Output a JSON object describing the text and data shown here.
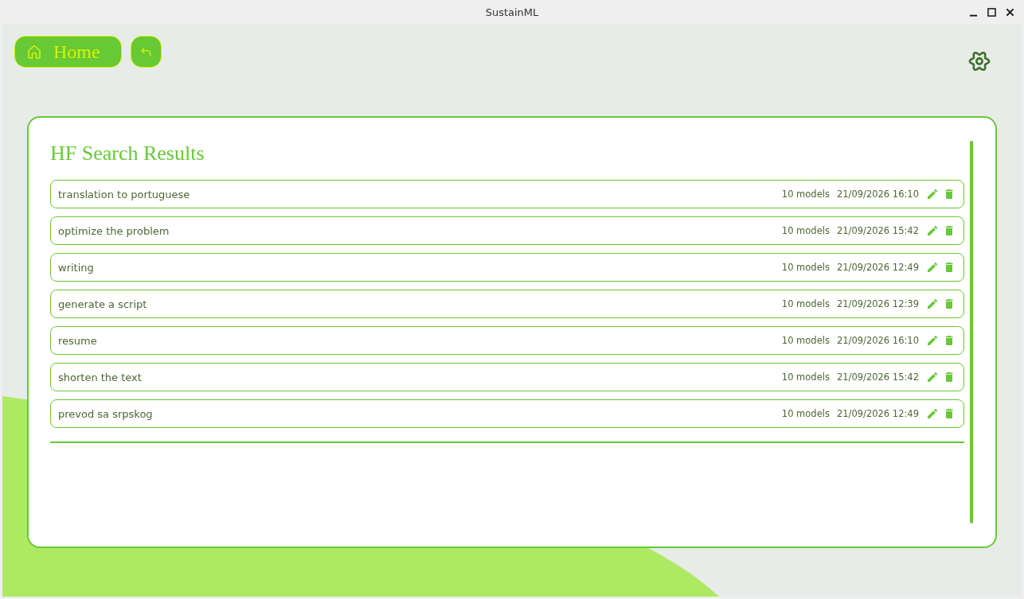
{
  "window": {
    "title": "SustainML"
  },
  "toolbar": {
    "home_button": {
      "label": "Home"
    }
  },
  "results": {
    "title": "HF Search Results",
    "items": [
      {
        "query": "translation to portuguese",
        "models": "10 models",
        "date": "21/09/2026 16:10"
      },
      {
        "query": "optimize the problem",
        "models": "10 models",
        "date": "21/09/2026 15:42"
      },
      {
        "query": "writing",
        "models": "10 models",
        "date": "21/09/2026 12:49"
      },
      {
        "query": "generate a script",
        "models": "10 models",
        "date": "21/09/2026 12:39"
      },
      {
        "query": "resume",
        "models": "10 models",
        "date": "21/09/2026 16:10"
      },
      {
        "query": "shorten the text",
        "models": "10 models",
        "date": "21/09/2026 15:42"
      },
      {
        "query": "prevod sa srpskog",
        "models": "10 models",
        "date": "21/09/2026 12:49"
      }
    ]
  }
}
